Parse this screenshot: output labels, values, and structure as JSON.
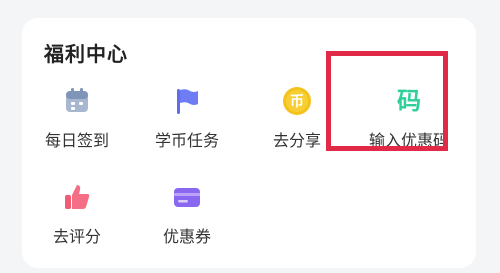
{
  "panel": {
    "title": "福利中心",
    "items": [
      {
        "label": "每日签到",
        "icon": "calendar-icon"
      },
      {
        "label": "学币任务",
        "icon": "flag-icon"
      },
      {
        "label": "去分享",
        "icon": "coin-icon",
        "icon_text": "币"
      },
      {
        "label": "输入优惠码",
        "icon": "code-icon",
        "icon_text": "码"
      },
      {
        "label": "去评分",
        "icon": "thumbs-up-icon"
      },
      {
        "label": "优惠券",
        "icon": "coupon-card-icon"
      }
    ]
  },
  "colors": {
    "calendar": "#7f95b8",
    "flag": "#5f6cf0",
    "coin": "#f3c21b",
    "code": "#2fcf9b",
    "thumbs": "#f15b74",
    "coupon": "#8a67f0",
    "highlight": "#e02a48"
  }
}
